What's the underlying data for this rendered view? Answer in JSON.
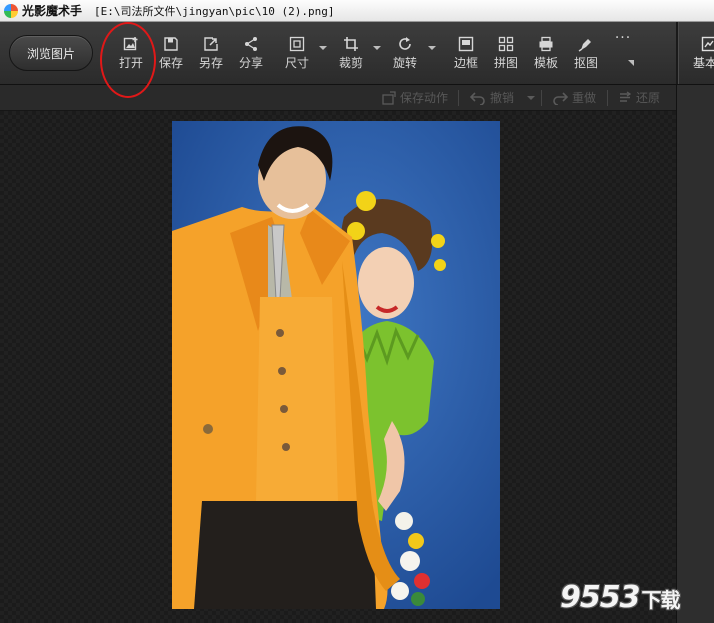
{
  "window": {
    "app_name": "光影魔术手",
    "file_path": "[E:\\司法所文件\\jingyan\\pic\\10 (2).png]"
  },
  "toolbar": {
    "browse_label": "浏览图片",
    "tools": [
      {
        "name": "open",
        "label": "打开",
        "icon": "open-image-icon"
      },
      {
        "name": "save",
        "label": "保存",
        "icon": "save-icon"
      },
      {
        "name": "save-as",
        "label": "另存",
        "icon": "save-as-icon"
      },
      {
        "name": "share",
        "label": "分享",
        "icon": "share-icon"
      },
      {
        "name": "size",
        "label": "尺寸",
        "icon": "resize-icon"
      },
      {
        "name": "crop",
        "label": "裁剪",
        "icon": "crop-icon"
      },
      {
        "name": "rotate",
        "label": "旋转",
        "icon": "rotate-icon"
      },
      {
        "name": "border",
        "label": "边框",
        "icon": "border-icon"
      },
      {
        "name": "collage",
        "label": "拼图",
        "icon": "grid-icon"
      },
      {
        "name": "template",
        "label": "模板",
        "icon": "template-icon"
      },
      {
        "name": "cutout",
        "label": "抠图",
        "icon": "pen-icon"
      }
    ],
    "more_label": "···",
    "basic_label": "基本"
  },
  "actions": {
    "save_action": "保存动作",
    "undo": "撤销",
    "redo": "重做",
    "restore": "还原"
  },
  "watermark": {
    "number": "9553",
    "suffix": "下载"
  },
  "colors": {
    "highlight_circle": "#e01818",
    "photo_background": "#2a5aa6",
    "suit": "#f5a22a"
  }
}
